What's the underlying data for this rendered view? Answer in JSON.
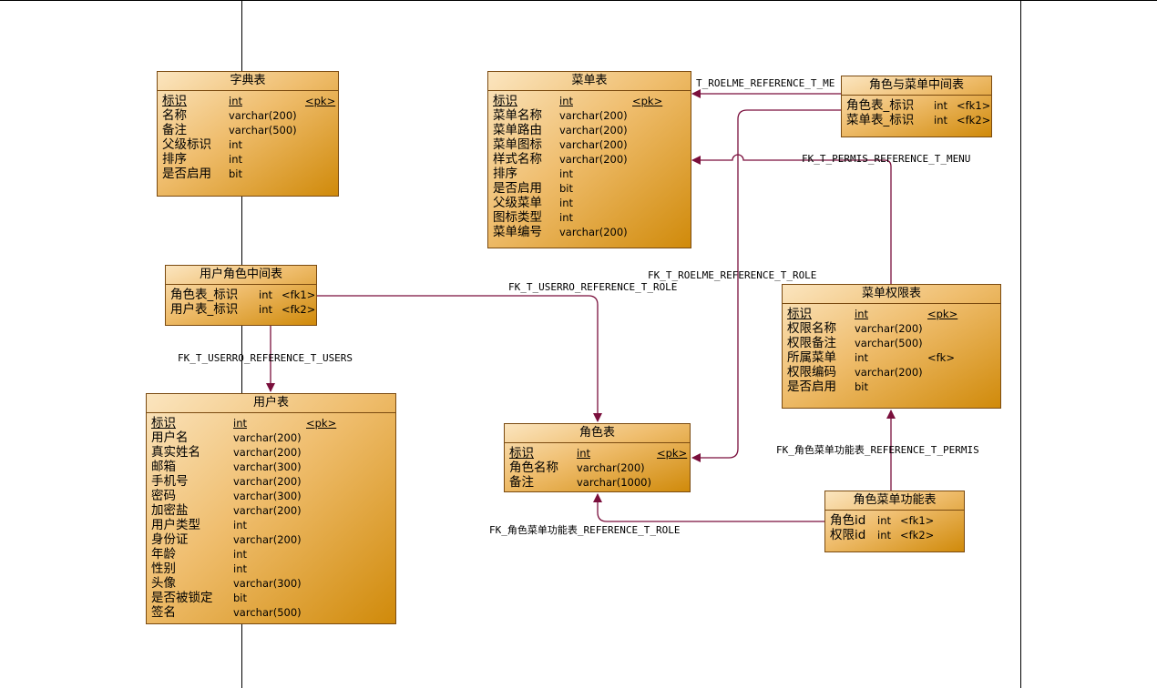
{
  "entities": {
    "dict": {
      "title": "字典表",
      "cols": [
        {
          "name": "标识",
          "type": "int",
          "key": "<pk>"
        },
        {
          "name": "名称",
          "type": "varchar(200)",
          "key": ""
        },
        {
          "name": "备注",
          "type": "varchar(500)",
          "key": ""
        },
        {
          "name": "父级标识",
          "type": "int",
          "key": ""
        },
        {
          "name": "排序",
          "type": "int",
          "key": ""
        },
        {
          "name": "是否启用",
          "type": "bit",
          "key": ""
        }
      ]
    },
    "menu": {
      "title": "菜单表",
      "cols": [
        {
          "name": "标识",
          "type": "int",
          "key": "<pk>"
        },
        {
          "name": "菜单名称",
          "type": "varchar(200)",
          "key": ""
        },
        {
          "name": "菜单路由",
          "type": "varchar(200)",
          "key": ""
        },
        {
          "name": "菜单图标",
          "type": "varchar(200)",
          "key": ""
        },
        {
          "name": "样式名称",
          "type": "varchar(200)",
          "key": ""
        },
        {
          "name": "排序",
          "type": "int",
          "key": ""
        },
        {
          "name": "是否启用",
          "type": "bit",
          "key": ""
        },
        {
          "name": "父级菜单",
          "type": "int",
          "key": ""
        },
        {
          "name": "图标类型",
          "type": "int",
          "key": ""
        },
        {
          "name": "菜单编号",
          "type": "varchar(200)",
          "key": ""
        }
      ]
    },
    "role_menu": {
      "title": "角色与菜单中间表",
      "cols": [
        {
          "name": "角色表_标识",
          "type": "int",
          "key": "<fk1>"
        },
        {
          "name": "菜单表_标识",
          "type": "int",
          "key": "<fk2>"
        }
      ]
    },
    "user_role": {
      "title": "用户角色中间表",
      "cols": [
        {
          "name": "角色表_标识",
          "type": "int",
          "key": "<fk1>"
        },
        {
          "name": "用户表_标识",
          "type": "int",
          "key": "<fk2>"
        }
      ]
    },
    "perm": {
      "title": "菜单权限表",
      "cols": [
        {
          "name": "标识",
          "type": "int",
          "key": "<pk>"
        },
        {
          "name": "权限名称",
          "type": "varchar(200)",
          "key": ""
        },
        {
          "name": "权限备注",
          "type": "varchar(500)",
          "key": ""
        },
        {
          "name": "所属菜单",
          "type": "int",
          "key": "<fk>"
        },
        {
          "name": "权限编码",
          "type": "varchar(200)",
          "key": ""
        },
        {
          "name": "是否启用",
          "type": "bit",
          "key": ""
        }
      ]
    },
    "users": {
      "title": "用户表",
      "cols": [
        {
          "name": "标识",
          "type": "int",
          "key": "<pk>"
        },
        {
          "name": "用户名",
          "type": "varchar(200)",
          "key": ""
        },
        {
          "name": "真实姓名",
          "type": "varchar(200)",
          "key": ""
        },
        {
          "name": "邮箱",
          "type": "varchar(300)",
          "key": ""
        },
        {
          "name": "手机号",
          "type": "varchar(200)",
          "key": ""
        },
        {
          "name": "密码",
          "type": "varchar(300)",
          "key": ""
        },
        {
          "name": "加密盐",
          "type": "varchar(200)",
          "key": ""
        },
        {
          "name": "用户类型",
          "type": "int",
          "key": ""
        },
        {
          "name": "身份证",
          "type": "varchar(200)",
          "key": ""
        },
        {
          "name": "年龄",
          "type": "int",
          "key": ""
        },
        {
          "name": "性别",
          "type": "int",
          "key": ""
        },
        {
          "name": "头像",
          "type": "varchar(300)",
          "key": ""
        },
        {
          "name": "是否被锁定",
          "type": "bit",
          "key": ""
        },
        {
          "name": "签名",
          "type": "varchar(500)",
          "key": ""
        }
      ]
    },
    "role": {
      "title": "角色表",
      "cols": [
        {
          "name": "标识",
          "type": "int",
          "key": "<pk>"
        },
        {
          "name": "角色名称",
          "type": "varchar(200)",
          "key": ""
        },
        {
          "name": "备注",
          "type": "varchar(1000)",
          "key": ""
        }
      ]
    },
    "role_perm": {
      "title": "角色菜单功能表",
      "cols": [
        {
          "name": "角色id",
          "type": "int",
          "key": "<fk1>"
        },
        {
          "name": "权限id",
          "type": "int",
          "key": "<fk2>"
        }
      ]
    }
  },
  "relations": {
    "roelme_menu": "T_ROELME_REFERENCE_T_ME",
    "permis_menu": "FK_T_PERMIS_REFERENCE_T_MENU",
    "roelme_role": "FK_T_ROELME_REFERENCE_T_ROLE",
    "userro_role": "FK_T_USERRO_REFERENCE_T_ROLE",
    "userro_users": "FK_T_USERRO_REFERENCE_T_USERS",
    "rp_permis": "FK_角色菜单功能表_REFERENCE_T_PERMIS",
    "rp_role": "FK_角色菜单功能表_REFERENCE_T_ROLE"
  },
  "colors": {
    "line": "#7a0f3c",
    "entity_border": "#7a4a10",
    "entity_fill_light": "#fbe5bf",
    "entity_fill_dark": "#d08a0a"
  }
}
